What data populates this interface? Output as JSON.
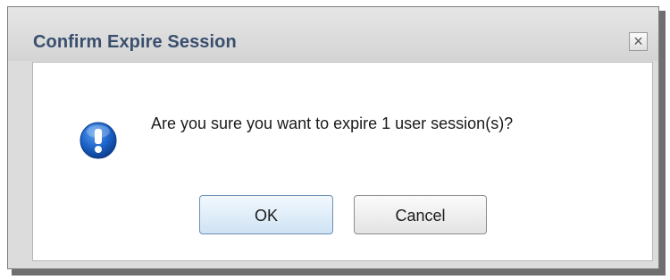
{
  "dialog": {
    "title": "Confirm Expire Session",
    "close_label": "×",
    "message": "Are you sure you want to expire 1 user session(s)?",
    "icon": "alert-exclamation-icon",
    "ok_label": "OK",
    "cancel_label": "Cancel"
  },
  "colors": {
    "title_text": "#3a4f6e",
    "icon_blue": "#1b62c8",
    "ok_border": "#6b8fb5"
  }
}
